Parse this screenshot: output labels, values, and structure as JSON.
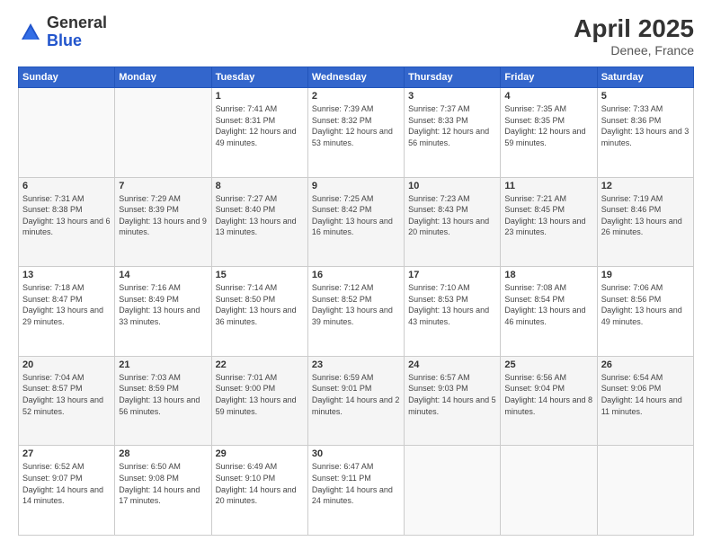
{
  "header": {
    "logo_general": "General",
    "logo_blue": "Blue",
    "month_year": "April 2025",
    "location": "Denee, France"
  },
  "days_of_week": [
    "Sunday",
    "Monday",
    "Tuesday",
    "Wednesday",
    "Thursday",
    "Friday",
    "Saturday"
  ],
  "weeks": [
    [
      {
        "day": "",
        "info": ""
      },
      {
        "day": "",
        "info": ""
      },
      {
        "day": "1",
        "info": "Sunrise: 7:41 AM\nSunset: 8:31 PM\nDaylight: 12 hours and 49 minutes."
      },
      {
        "day": "2",
        "info": "Sunrise: 7:39 AM\nSunset: 8:32 PM\nDaylight: 12 hours and 53 minutes."
      },
      {
        "day": "3",
        "info": "Sunrise: 7:37 AM\nSunset: 8:33 PM\nDaylight: 12 hours and 56 minutes."
      },
      {
        "day": "4",
        "info": "Sunrise: 7:35 AM\nSunset: 8:35 PM\nDaylight: 12 hours and 59 minutes."
      },
      {
        "day": "5",
        "info": "Sunrise: 7:33 AM\nSunset: 8:36 PM\nDaylight: 13 hours and 3 minutes."
      }
    ],
    [
      {
        "day": "6",
        "info": "Sunrise: 7:31 AM\nSunset: 8:38 PM\nDaylight: 13 hours and 6 minutes."
      },
      {
        "day": "7",
        "info": "Sunrise: 7:29 AM\nSunset: 8:39 PM\nDaylight: 13 hours and 9 minutes."
      },
      {
        "day": "8",
        "info": "Sunrise: 7:27 AM\nSunset: 8:40 PM\nDaylight: 13 hours and 13 minutes."
      },
      {
        "day": "9",
        "info": "Sunrise: 7:25 AM\nSunset: 8:42 PM\nDaylight: 13 hours and 16 minutes."
      },
      {
        "day": "10",
        "info": "Sunrise: 7:23 AM\nSunset: 8:43 PM\nDaylight: 13 hours and 20 minutes."
      },
      {
        "day": "11",
        "info": "Sunrise: 7:21 AM\nSunset: 8:45 PM\nDaylight: 13 hours and 23 minutes."
      },
      {
        "day": "12",
        "info": "Sunrise: 7:19 AM\nSunset: 8:46 PM\nDaylight: 13 hours and 26 minutes."
      }
    ],
    [
      {
        "day": "13",
        "info": "Sunrise: 7:18 AM\nSunset: 8:47 PM\nDaylight: 13 hours and 29 minutes."
      },
      {
        "day": "14",
        "info": "Sunrise: 7:16 AM\nSunset: 8:49 PM\nDaylight: 13 hours and 33 minutes."
      },
      {
        "day": "15",
        "info": "Sunrise: 7:14 AM\nSunset: 8:50 PM\nDaylight: 13 hours and 36 minutes."
      },
      {
        "day": "16",
        "info": "Sunrise: 7:12 AM\nSunset: 8:52 PM\nDaylight: 13 hours and 39 minutes."
      },
      {
        "day": "17",
        "info": "Sunrise: 7:10 AM\nSunset: 8:53 PM\nDaylight: 13 hours and 43 minutes."
      },
      {
        "day": "18",
        "info": "Sunrise: 7:08 AM\nSunset: 8:54 PM\nDaylight: 13 hours and 46 minutes."
      },
      {
        "day": "19",
        "info": "Sunrise: 7:06 AM\nSunset: 8:56 PM\nDaylight: 13 hours and 49 minutes."
      }
    ],
    [
      {
        "day": "20",
        "info": "Sunrise: 7:04 AM\nSunset: 8:57 PM\nDaylight: 13 hours and 52 minutes."
      },
      {
        "day": "21",
        "info": "Sunrise: 7:03 AM\nSunset: 8:59 PM\nDaylight: 13 hours and 56 minutes."
      },
      {
        "day": "22",
        "info": "Sunrise: 7:01 AM\nSunset: 9:00 PM\nDaylight: 13 hours and 59 minutes."
      },
      {
        "day": "23",
        "info": "Sunrise: 6:59 AM\nSunset: 9:01 PM\nDaylight: 14 hours and 2 minutes."
      },
      {
        "day": "24",
        "info": "Sunrise: 6:57 AM\nSunset: 9:03 PM\nDaylight: 14 hours and 5 minutes."
      },
      {
        "day": "25",
        "info": "Sunrise: 6:56 AM\nSunset: 9:04 PM\nDaylight: 14 hours and 8 minutes."
      },
      {
        "day": "26",
        "info": "Sunrise: 6:54 AM\nSunset: 9:06 PM\nDaylight: 14 hours and 11 minutes."
      }
    ],
    [
      {
        "day": "27",
        "info": "Sunrise: 6:52 AM\nSunset: 9:07 PM\nDaylight: 14 hours and 14 minutes."
      },
      {
        "day": "28",
        "info": "Sunrise: 6:50 AM\nSunset: 9:08 PM\nDaylight: 14 hours and 17 minutes."
      },
      {
        "day": "29",
        "info": "Sunrise: 6:49 AM\nSunset: 9:10 PM\nDaylight: 14 hours and 20 minutes."
      },
      {
        "day": "30",
        "info": "Sunrise: 6:47 AM\nSunset: 9:11 PM\nDaylight: 14 hours and 24 minutes."
      },
      {
        "day": "",
        "info": ""
      },
      {
        "day": "",
        "info": ""
      },
      {
        "day": "",
        "info": ""
      }
    ]
  ]
}
